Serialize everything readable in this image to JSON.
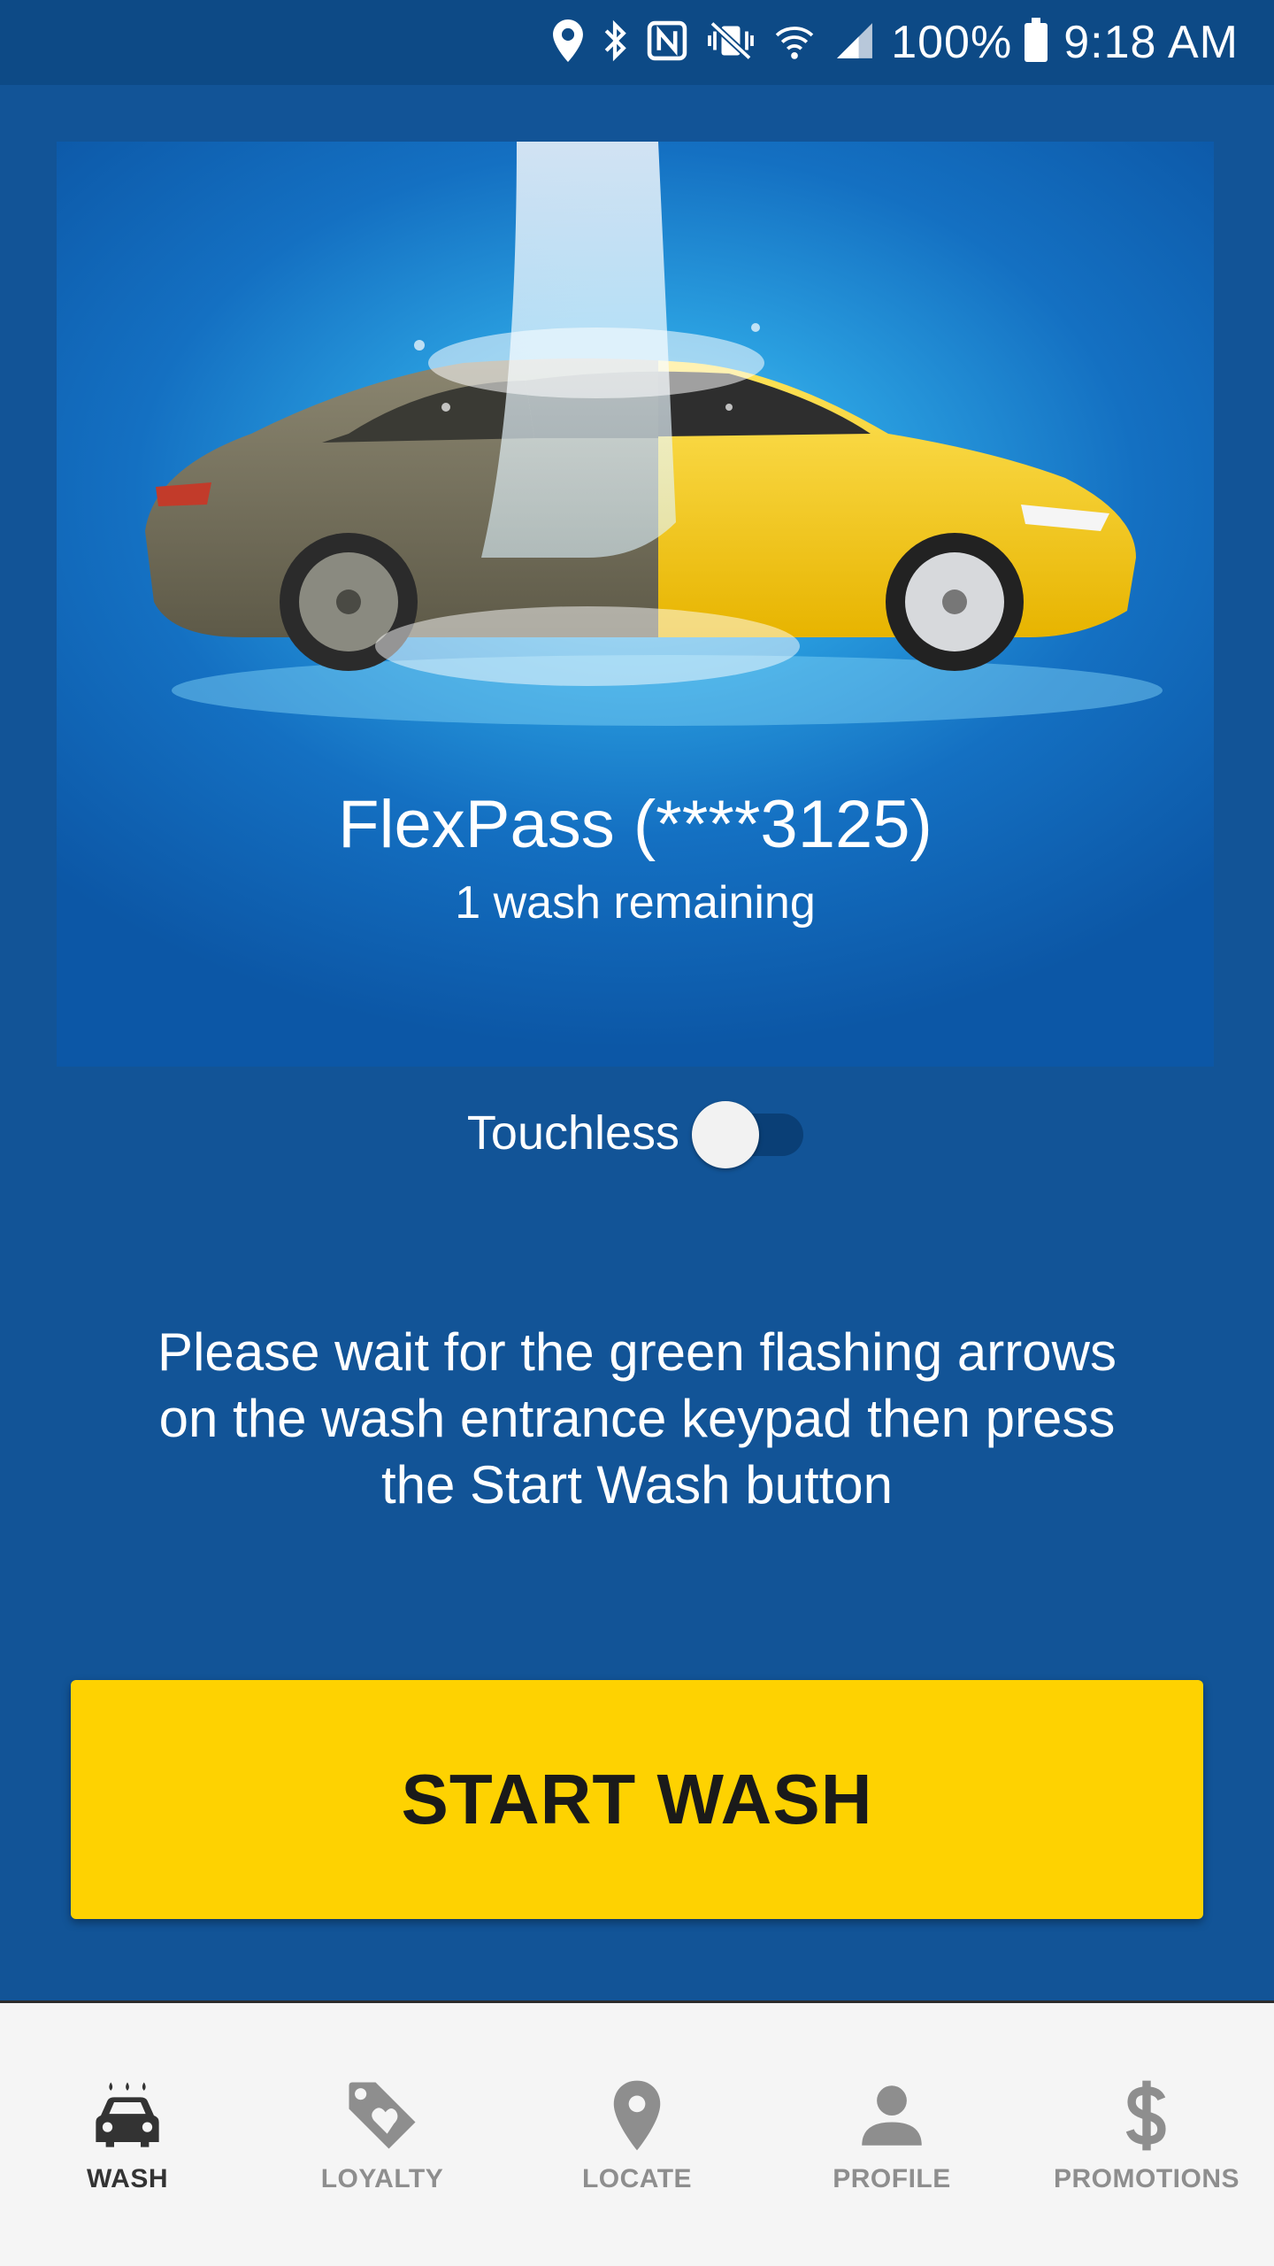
{
  "status_bar": {
    "battery": "100%",
    "time": "9:18 AM"
  },
  "hero": {
    "title": "FlexPass (****3125)",
    "subtitle": "1 wash remaining"
  },
  "touchless": {
    "label": "Touchless",
    "enabled": false
  },
  "instructions": "Please wait for the green flashing arrows on the wash entrance keypad then press the Start Wash button",
  "start_button": {
    "label": "START WASH"
  },
  "bottom_nav": {
    "items": [
      {
        "label": "WASH",
        "icon": "car-wash-icon",
        "active": true
      },
      {
        "label": "LOYALTY",
        "icon": "loyalty-tag-icon",
        "active": false
      },
      {
        "label": "LOCATE",
        "icon": "location-pin-icon",
        "active": false
      },
      {
        "label": "PROFILE",
        "icon": "person-icon",
        "active": false
      },
      {
        "label": "PROMOTIONS",
        "icon": "dollar-icon",
        "active": false
      }
    ]
  },
  "colors": {
    "background": "#125497",
    "status_bar": "#0d4a86",
    "button": "#fed201",
    "nav_active": "#333333",
    "nav_inactive": "#8e8e8e"
  }
}
